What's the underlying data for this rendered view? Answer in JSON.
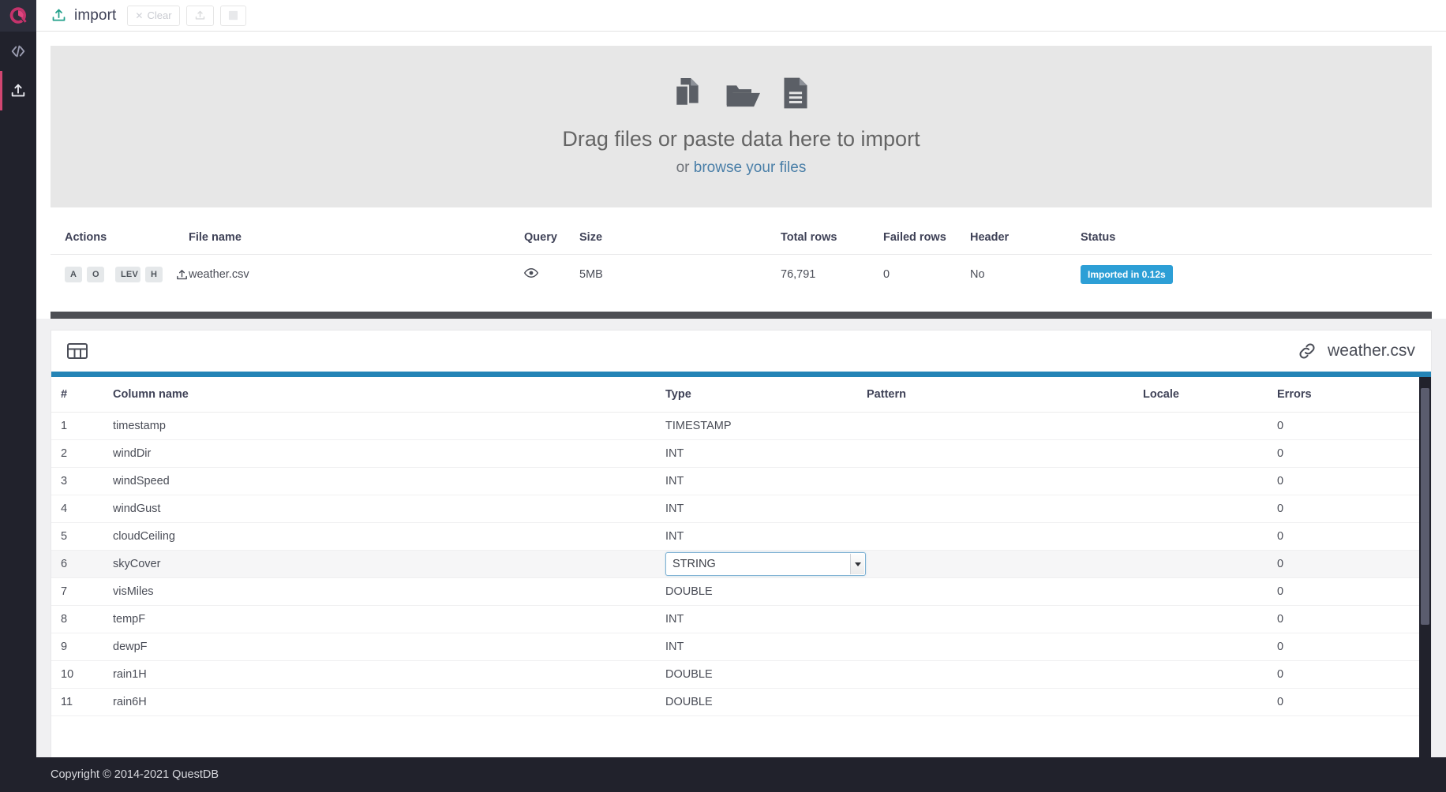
{
  "sidebar": {
    "logo_name": "questdb-logo",
    "items": [
      {
        "name": "console-icon",
        "label": "Console"
      },
      {
        "name": "import-icon",
        "label": "Import"
      }
    ]
  },
  "topbar": {
    "tab_label": "import",
    "clear_label": "Clear",
    "clear_glyph": "✕",
    "upload_button_label": "Upload",
    "stop_button_label": "Stop"
  },
  "dropzone": {
    "title": "Drag files or paste data here to import",
    "or_text": "or ",
    "link_text": "browse your files",
    "icons": [
      "copy-files-icon",
      "open-folder-icon",
      "document-icon"
    ]
  },
  "file_table": {
    "headers": {
      "actions": "Actions",
      "file_name": "File name",
      "query": "Query",
      "size": "Size",
      "total_rows": "Total rows",
      "failed_rows": "Failed rows",
      "header": "Header",
      "status": "Status"
    },
    "rows": [
      {
        "badges": [
          "A",
          "O",
          "LEV",
          "H"
        ],
        "file_name": "weather.csv",
        "size": "5MB",
        "total_rows": "76,791",
        "failed_rows": "0",
        "header": "No",
        "status": "Imported in 0.12s"
      }
    ]
  },
  "schema": {
    "file_name": "weather.csv",
    "headers": {
      "index": "#",
      "column_name": "Column name",
      "type": "Type",
      "pattern": "Pattern",
      "locale": "Locale",
      "errors": "Errors"
    },
    "active_row_index": 6,
    "active_type_value": "STRING",
    "rows": [
      {
        "index": "1",
        "column_name": "timestamp",
        "type": "TIMESTAMP",
        "pattern": "",
        "locale": "",
        "errors": "0"
      },
      {
        "index": "2",
        "column_name": "windDir",
        "type": "INT",
        "pattern": "",
        "locale": "",
        "errors": "0"
      },
      {
        "index": "3",
        "column_name": "windSpeed",
        "type": "INT",
        "pattern": "",
        "locale": "",
        "errors": "0"
      },
      {
        "index": "4",
        "column_name": "windGust",
        "type": "INT",
        "pattern": "",
        "locale": "",
        "errors": "0"
      },
      {
        "index": "5",
        "column_name": "cloudCeiling",
        "type": "INT",
        "pattern": "",
        "locale": "",
        "errors": "0"
      },
      {
        "index": "6",
        "column_name": "skyCover",
        "type": "STRING",
        "pattern": "",
        "locale": "",
        "errors": "0"
      },
      {
        "index": "7",
        "column_name": "visMiles",
        "type": "DOUBLE",
        "pattern": "",
        "locale": "",
        "errors": "0"
      },
      {
        "index": "8",
        "column_name": "tempF",
        "type": "INT",
        "pattern": "",
        "locale": "",
        "errors": "0"
      },
      {
        "index": "9",
        "column_name": "dewpF",
        "type": "INT",
        "pattern": "",
        "locale": "",
        "errors": "0"
      },
      {
        "index": "10",
        "column_name": "rain1H",
        "type": "DOUBLE",
        "pattern": "",
        "locale": "",
        "errors": "0"
      },
      {
        "index": "11",
        "column_name": "rain6H",
        "type": "DOUBLE",
        "pattern": "",
        "locale": "",
        "errors": "0"
      }
    ]
  },
  "footer": {
    "copyright": "Copyright © 2014-2021 QuestDB"
  },
  "colors": {
    "accent_pink": "#d14671",
    "sidebar_dark": "#21222c",
    "status_blue": "#2d9fd6",
    "bar_blue": "#2484b6",
    "link_blue": "#4a7fa8"
  }
}
